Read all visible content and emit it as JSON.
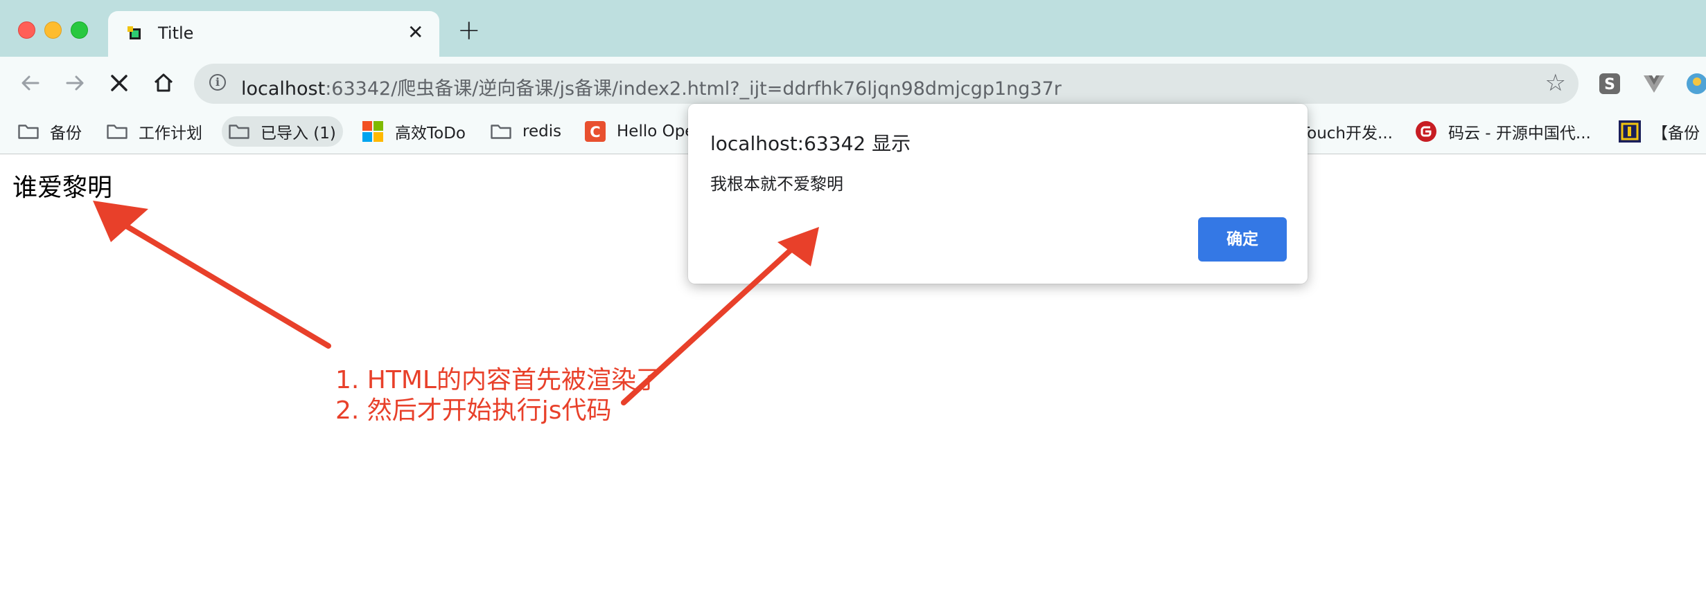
{
  "tab": {
    "title": "Title"
  },
  "omnibox": {
    "url_host": "localhost",
    "url_rest": ":63342/爬虫备课/逆向备课/js备课/index2.html?_ijt=ddrfhk76ljqn98dmjcgp1ng37r"
  },
  "bookmarks": [
    {
      "label": "备份",
      "icon": "folder-icon"
    },
    {
      "label": "工作计划",
      "icon": "folder-icon"
    },
    {
      "label": "已导入 (1)",
      "icon": "folder-icon"
    },
    {
      "label": "高效ToDo",
      "icon": "microsoft-todo-icon"
    },
    {
      "label": "redis",
      "icon": "folder-icon"
    },
    {
      "label": "Hello Ope",
      "icon": "c-logo-icon"
    },
    {
      "label": "Touch开发...",
      "icon": ""
    },
    {
      "label": "码云 - 开源中国代...",
      "icon": "gitee-icon"
    },
    {
      "label": "【备份",
      "icon": "bookmark-logo-icon"
    }
  ],
  "page": {
    "heading": "谁爱黎明"
  },
  "dialog": {
    "title": "localhost:63342 显示",
    "message": "我根本就不爱黎明",
    "ok_label": "确定"
  },
  "annotation": {
    "line1": "1. HTML的内容首先被渲染了",
    "line2": "2. 然后才开始执行js代码",
    "color": "#e8402a"
  },
  "colors": {
    "accent": "#3478e5",
    "tabstrip": "#bedfdf",
    "toolbar": "#f5fafa"
  }
}
